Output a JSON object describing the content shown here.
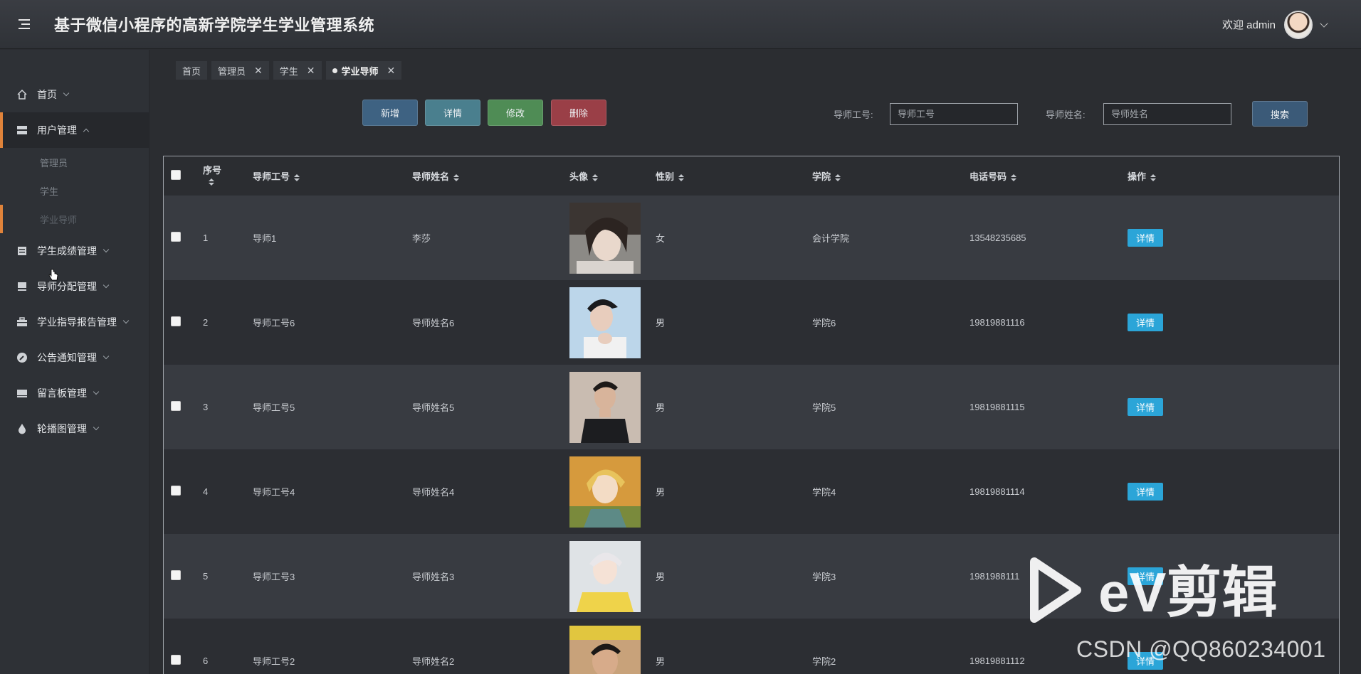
{
  "header": {
    "title": "基于微信小程序的高新学院学生学业管理系统",
    "welcome": "欢迎 admin",
    "icons": [
      "menu-icon",
      "avatar",
      "chevron-down-icon"
    ]
  },
  "sidebar": {
    "items": [
      {
        "label": "首页",
        "icon": "home-icon"
      },
      {
        "label": "用户管理",
        "icon": "users-icon"
      },
      {
        "label": "学生成绩管理",
        "icon": "grade-icon"
      },
      {
        "label": "导师分配管理",
        "icon": "assign-icon"
      },
      {
        "label": "学业指导报告管理",
        "icon": "report-icon"
      },
      {
        "label": "公告通知管理",
        "icon": "notice-icon"
      },
      {
        "label": "留言板管理",
        "icon": "message-icon"
      },
      {
        "label": "轮播图管理",
        "icon": "carousel-icon"
      }
    ],
    "user_sub": [
      "管理员",
      "学生",
      "学业导师"
    ]
  },
  "tabs": [
    {
      "label": "首页"
    },
    {
      "label": "管理员"
    },
    {
      "label": "学生"
    },
    {
      "label": "学业导师"
    }
  ],
  "toolbar": {
    "add": "新增",
    "detail": "详情",
    "edit": "修改",
    "delete": "删除",
    "search": "搜索"
  },
  "filters": {
    "id_label": "导师工号:",
    "id_placeholder": "导师工号",
    "name_label": "导师姓名:",
    "name_placeholder": "导师姓名"
  },
  "table": {
    "columns": [
      "序号",
      "导师工号",
      "导师姓名",
      "头像",
      "性别",
      "学院",
      "电话号码",
      "操作"
    ],
    "rows": [
      {
        "idx": "1",
        "id": "导师1",
        "name": "李莎",
        "gender": "女",
        "college": "会计学院",
        "phone": "13548235685",
        "action": "详情"
      },
      {
        "idx": "2",
        "id": "导师工号6",
        "name": "导师姓名6",
        "gender": "男",
        "college": "学院6",
        "phone": "19819881116",
        "action": "详情"
      },
      {
        "idx": "3",
        "id": "导师工号5",
        "name": "导师姓名5",
        "gender": "男",
        "college": "学院5",
        "phone": "19819881115",
        "action": "详情"
      },
      {
        "idx": "4",
        "id": "导师工号4",
        "name": "导师姓名4",
        "gender": "男",
        "college": "学院4",
        "phone": "19819881114",
        "action": "详情"
      },
      {
        "idx": "5",
        "id": "导师工号3",
        "name": "导师姓名3",
        "gender": "男",
        "college": "学院3",
        "phone": "1981988111",
        "action": "详情"
      },
      {
        "idx": "6",
        "id": "导师工号2",
        "name": "导师姓名2",
        "gender": "男",
        "college": "学院2",
        "phone": "19819881112",
        "action": "详情"
      }
    ]
  },
  "watermark": {
    "logo_text": "eV剪辑",
    "text": "CSDN @QQ860234001"
  },
  "colors": {
    "accent": "#e0833a",
    "add": "#3e6282",
    "detail": "#4a7f8e",
    "edit": "#4f8c55",
    "delete": "#9a3f47",
    "row_detail": "#2ba5d8"
  }
}
